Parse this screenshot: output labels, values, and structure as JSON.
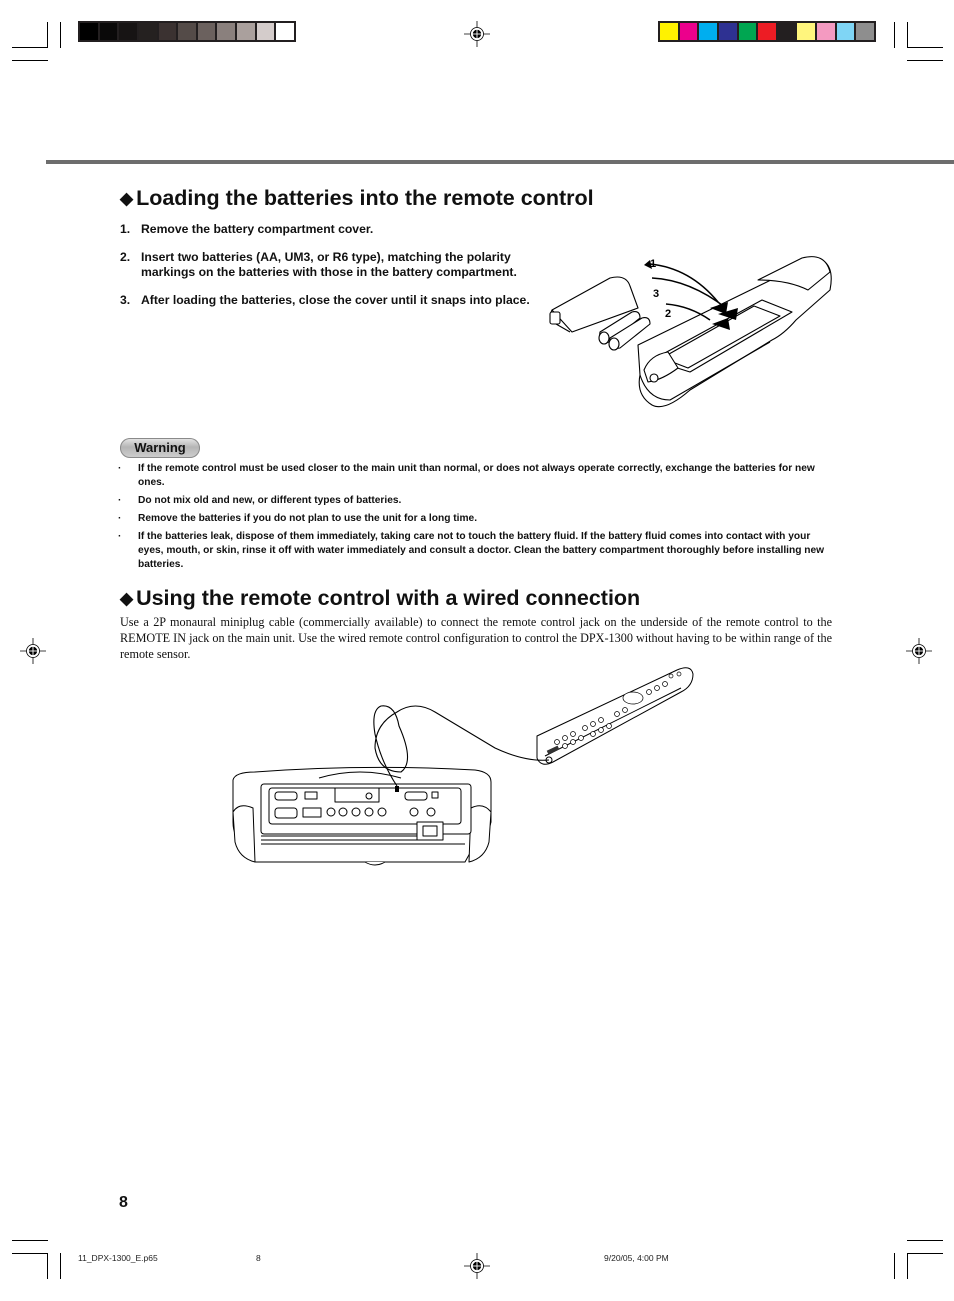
{
  "print_marks": {
    "grayscale_bar": [
      "#000000",
      "#0a0909",
      "#171414",
      "#252120",
      "#3b3231",
      "#544b48",
      "#6b615e",
      "#8a807d",
      "#aaa09d",
      "#d4cccb",
      "#ffffff"
    ],
    "color_bar": [
      "#fff200",
      "#ec008c",
      "#00aeef",
      "#2e3192",
      "#00a651",
      "#ed1c24",
      "#231f20",
      "#fff57d",
      "#f49ac1",
      "#7fd5f5",
      "#8e8e8e"
    ]
  },
  "section1": {
    "title": "Loading the batteries into the remote control",
    "bullet_icon": "◆",
    "steps": [
      {
        "num": "1.",
        "text": "Remove the battery compartment cover."
      },
      {
        "num": "2.",
        "text": "Insert two batteries (AA, UM3, or R6 type), matching the polarity markings on the batteries with those in the battery compartment."
      },
      {
        "num": "3.",
        "text": "After loading the batteries, close the cover until it snaps into place."
      }
    ],
    "figure_labels": [
      "1",
      "3",
      "2"
    ]
  },
  "warning": {
    "badge": "Warning",
    "bullet": "·",
    "items": [
      "If the remote control must be used closer to the main unit than normal, or does not always operate correctly, exchange the batteries for new ones.",
      "Do not mix old and new, or different types of batteries.",
      "Remove the batteries if you do not plan to use the unit for a long time.",
      "If the batteries leak, dispose of them immediately, taking care not to touch the battery fluid. If the battery fluid comes into contact with your eyes, mouth, or skin, rinse it off with water immediately and consult a doctor. Clean the battery compartment thoroughly before installing new batteries."
    ]
  },
  "section2": {
    "title": "Using the remote control with a wired connection",
    "bullet_icon": "◆",
    "body": "Use a 2P monaural miniplug cable (commercially available) to connect the remote control jack on the underside of the remote control to the REMOTE IN jack on the main unit. Use the wired remote control configuration to control the DPX-1300 without having to be within range of the remote sensor."
  },
  "page_number": "8",
  "footer": {
    "filename": "11_DPX-1300_E.p65",
    "page": "8",
    "timestamp": "9/20/05, 4:00 PM"
  }
}
